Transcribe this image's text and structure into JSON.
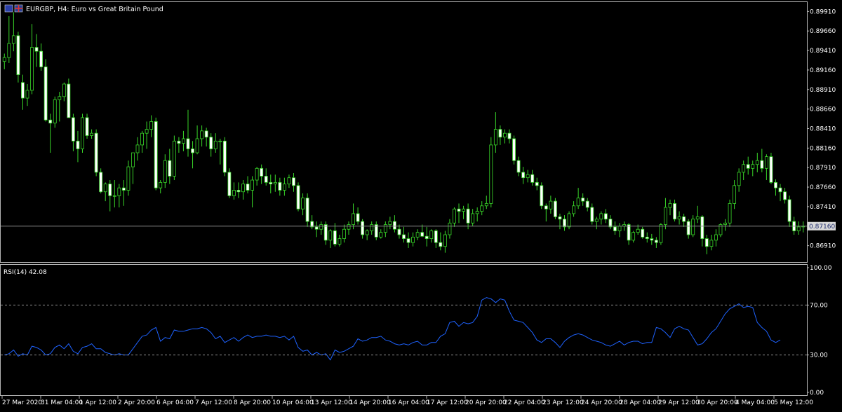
{
  "header": {
    "symbol_text": "EURGBP, H4:  Euro vs Great Britain Pound"
  },
  "colors": {
    "background": "#000000",
    "frame": "#b4b4b4",
    "bull_candle": "#39d829",
    "bear_body": "#ffffff",
    "price_line": "#8c8c8c",
    "rsi_line": "#1e62ff",
    "level_line": "#8c8c8c",
    "price_tag_bg": "#d8d8d8",
    "price_tag_text": "#1c2a6e"
  },
  "price_axis": {
    "ticks": [
      "0.89910",
      "0.89660",
      "0.89410",
      "0.89160",
      "0.88910",
      "0.88660",
      "0.88410",
      "0.88160",
      "0.87910",
      "0.87660",
      "0.87410",
      "0.87160",
      "0.86910"
    ],
    "current_price": "0.87160"
  },
  "rsi_panel": {
    "label": "RSI(14) 42.08",
    "ticks": [
      "100.00",
      "70.00",
      "30.00",
      "0.00"
    ],
    "levels": [
      70,
      30
    ]
  },
  "time_axis": {
    "labels": [
      "27 Mar 2020",
      "31 Mar 04:00",
      "1 Apr 12:00",
      "2 Apr 20:00",
      "6 Apr 04:00",
      "7 Apr 12:00",
      "8 Apr 20:00",
      "10 Apr 04:00",
      "13 Apr 12:00",
      "14 Apr 20:00",
      "16 Apr 04:00",
      "17 Apr 12:00",
      "20 Apr 20:00",
      "22 Apr 04:00",
      "23 Apr 12:00",
      "24 Apr 20:00",
      "28 Apr 04:00",
      "29 Apr 12:00",
      "30 Apr 20:00",
      "4 May 04:00",
      "5 May 12:00"
    ]
  },
  "chart_data": [
    {
      "type": "candlestick",
      "title": "EURGBP, H4:  Euro vs Great Britain Pound",
      "ylim": [
        0.867,
        0.9003
      ],
      "current_price": 0.8716,
      "candles": [
        [
          0.8927,
          0.8937,
          0.8917,
          0.8932
        ],
        [
          0.8932,
          0.8985,
          0.8925,
          0.895
        ],
        [
          0.895,
          0.899,
          0.894,
          0.896
        ],
        [
          0.896,
          0.8965,
          0.89,
          0.891
        ],
        [
          0.89,
          0.891,
          0.8865,
          0.888
        ],
        [
          0.888,
          0.8898,
          0.887,
          0.889
        ],
        [
          0.889,
          0.8975,
          0.8885,
          0.8945
        ],
        [
          0.8945,
          0.8962,
          0.892,
          0.894
        ],
        [
          0.894,
          0.895,
          0.8915,
          0.892
        ],
        [
          0.892,
          0.893,
          0.885,
          0.8852
        ],
        [
          0.8852,
          0.886,
          0.881,
          0.8848
        ],
        [
          0.8848,
          0.8882,
          0.8842,
          0.8878
        ],
        [
          0.8878,
          0.8888,
          0.885,
          0.8882
        ],
        [
          0.8882,
          0.89,
          0.8876,
          0.8898
        ],
        [
          0.8898,
          0.8905,
          0.8855,
          0.8855
        ],
        [
          0.8855,
          0.886,
          0.8812,
          0.8825
        ],
        [
          0.8825,
          0.8838,
          0.8798,
          0.8815
        ],
        [
          0.8815,
          0.886,
          0.881,
          0.8855
        ],
        [
          0.8855,
          0.886,
          0.8828,
          0.8832
        ],
        [
          0.8832,
          0.884,
          0.8828,
          0.8835
        ],
        [
          0.8835,
          0.884,
          0.878,
          0.8785
        ],
        [
          0.8785,
          0.879,
          0.8758,
          0.876
        ],
        [
          0.876,
          0.8772,
          0.8748,
          0.877
        ],
        [
          0.877,
          0.8775,
          0.8735,
          0.8755
        ],
        [
          0.8755,
          0.8775,
          0.874,
          0.8755
        ],
        [
          0.8755,
          0.877,
          0.874,
          0.8765
        ],
        [
          0.8765,
          0.8775,
          0.8742,
          0.8762
        ],
        [
          0.8762,
          0.88,
          0.8755,
          0.8792
        ],
        [
          0.8792,
          0.881,
          0.877,
          0.881
        ],
        [
          0.881,
          0.883,
          0.88,
          0.882
        ],
        [
          0.882,
          0.8838,
          0.881,
          0.8835
        ],
        [
          0.8835,
          0.885,
          0.8815,
          0.884
        ],
        [
          0.884,
          0.8858,
          0.883,
          0.885
        ],
        [
          0.885,
          0.8855,
          0.8762,
          0.8765
        ],
        [
          0.8765,
          0.8775,
          0.8758,
          0.8772
        ],
        [
          0.8772,
          0.8808,
          0.8765,
          0.88
        ],
        [
          0.88,
          0.8815,
          0.877,
          0.878
        ],
        [
          0.878,
          0.8832,
          0.8775,
          0.8825
        ],
        [
          0.8825,
          0.883,
          0.881,
          0.8822
        ],
        [
          0.8822,
          0.8838,
          0.8812,
          0.8828
        ],
        [
          0.8828,
          0.8865,
          0.8805,
          0.8815
        ],
        [
          0.8815,
          0.8825,
          0.879,
          0.881
        ],
        [
          0.881,
          0.8845,
          0.8808,
          0.8828
        ],
        [
          0.8828,
          0.8845,
          0.8818,
          0.8838
        ],
        [
          0.8838,
          0.8842,
          0.8818,
          0.883
        ],
        [
          0.883,
          0.8835,
          0.8805,
          0.8815
        ],
        [
          0.8815,
          0.8835,
          0.881,
          0.8825
        ],
        [
          0.8825,
          0.8828,
          0.8795,
          0.8825
        ],
        [
          0.8825,
          0.883,
          0.878,
          0.8785
        ],
        [
          0.8785,
          0.879,
          0.8752,
          0.8755
        ],
        [
          0.8755,
          0.8772,
          0.875,
          0.8762
        ],
        [
          0.8762,
          0.8772,
          0.8752,
          0.876
        ],
        [
          0.876,
          0.8775,
          0.875,
          0.877
        ],
        [
          0.877,
          0.878,
          0.8758,
          0.8762
        ],
        [
          0.8762,
          0.878,
          0.874,
          0.8775
        ],
        [
          0.8775,
          0.8792,
          0.8768,
          0.879
        ],
        [
          0.879,
          0.8795,
          0.877,
          0.878
        ],
        [
          0.878,
          0.879,
          0.8768,
          0.8772
        ],
        [
          0.8772,
          0.8782,
          0.8758,
          0.877
        ],
        [
          0.877,
          0.8782,
          0.876,
          0.8772
        ],
        [
          0.8772,
          0.8778,
          0.8755,
          0.8762
        ],
        [
          0.8762,
          0.8778,
          0.8755,
          0.877
        ],
        [
          0.877,
          0.8782,
          0.8765,
          0.8778
        ],
        [
          0.8778,
          0.8784,
          0.876,
          0.8768
        ],
        [
          0.8768,
          0.8772,
          0.8735,
          0.8738
        ],
        [
          0.8738,
          0.8758,
          0.873,
          0.8752
        ],
        [
          0.8752,
          0.8758,
          0.8715,
          0.8722
        ],
        [
          0.8722,
          0.873,
          0.8712,
          0.8715
        ],
        [
          0.8715,
          0.8722,
          0.8702,
          0.8712
        ],
        [
          0.8712,
          0.8722,
          0.8705,
          0.8718
        ],
        [
          0.8718,
          0.8722,
          0.8692,
          0.8698
        ],
        [
          0.8698,
          0.8712,
          0.8688,
          0.871
        ],
        [
          0.871,
          0.872,
          0.869,
          0.8693
        ],
        [
          0.8693,
          0.8705,
          0.869,
          0.87
        ],
        [
          0.87,
          0.8718,
          0.8695,
          0.8712
        ],
        [
          0.8712,
          0.8722,
          0.8705,
          0.8718
        ],
        [
          0.8718,
          0.8745,
          0.8712,
          0.8732
        ],
        [
          0.8732,
          0.874,
          0.8718,
          0.8722
        ],
        [
          0.8722,
          0.8725,
          0.87,
          0.8705
        ],
        [
          0.8705,
          0.8712,
          0.8698,
          0.871
        ],
        [
          0.871,
          0.8722,
          0.8705,
          0.8718
        ],
        [
          0.8718,
          0.8722,
          0.8698,
          0.8702
        ],
        [
          0.8702,
          0.8712,
          0.87,
          0.8708
        ],
        [
          0.8708,
          0.8722,
          0.8702,
          0.8718
        ],
        [
          0.8718,
          0.8728,
          0.8712,
          0.8722
        ],
        [
          0.8722,
          0.873,
          0.8708,
          0.8712
        ],
        [
          0.8712,
          0.8718,
          0.87,
          0.8705
        ],
        [
          0.8705,
          0.8715,
          0.8695,
          0.87
        ],
        [
          0.87,
          0.8708,
          0.8688,
          0.8695
        ],
        [
          0.8695,
          0.8708,
          0.869,
          0.8702
        ],
        [
          0.8702,
          0.8712,
          0.8698,
          0.8708
        ],
        [
          0.8708,
          0.8718,
          0.8702,
          0.8703
        ],
        [
          0.8703,
          0.8715,
          0.869,
          0.87
        ],
        [
          0.87,
          0.8712,
          0.8695,
          0.871
        ],
        [
          0.871,
          0.8712,
          0.8688,
          0.8695
        ],
        [
          0.8695,
          0.8708,
          0.8685,
          0.869
        ],
        [
          0.869,
          0.871,
          0.8682,
          0.8705
        ],
        [
          0.8705,
          0.8725,
          0.87,
          0.872
        ],
        [
          0.872,
          0.874,
          0.8715,
          0.8738
        ],
        [
          0.8738,
          0.8745,
          0.872,
          0.8735
        ],
        [
          0.8735,
          0.8742,
          0.8725,
          0.8738
        ],
        [
          0.8738,
          0.8745,
          0.8712,
          0.872
        ],
        [
          0.872,
          0.8738,
          0.8716,
          0.8732
        ],
        [
          0.8732,
          0.874,
          0.8722,
          0.8735
        ],
        [
          0.8735,
          0.8748,
          0.873,
          0.8742
        ],
        [
          0.8742,
          0.8755,
          0.8738,
          0.8745
        ],
        [
          0.8745,
          0.883,
          0.874,
          0.882
        ],
        [
          0.882,
          0.8862,
          0.881,
          0.884
        ],
        [
          0.884,
          0.8845,
          0.882,
          0.883
        ],
        [
          0.883,
          0.884,
          0.8822,
          0.8835
        ],
        [
          0.8835,
          0.884,
          0.8822,
          0.8828
        ],
        [
          0.8828,
          0.8832,
          0.8795,
          0.88
        ],
        [
          0.88,
          0.8805,
          0.878,
          0.8785
        ],
        [
          0.8785,
          0.8792,
          0.877,
          0.8778
        ],
        [
          0.8778,
          0.8788,
          0.8772,
          0.8782
        ],
        [
          0.8782,
          0.8788,
          0.8768,
          0.8772
        ],
        [
          0.8772,
          0.8778,
          0.8762,
          0.8768
        ],
        [
          0.8768,
          0.8772,
          0.8738,
          0.8742
        ],
        [
          0.8742,
          0.8745,
          0.8722,
          0.8738
        ],
        [
          0.8738,
          0.8755,
          0.8732,
          0.8748
        ],
        [
          0.8748,
          0.8752,
          0.8725,
          0.8728
        ],
        [
          0.8728,
          0.8732,
          0.8712,
          0.8725
        ],
        [
          0.8725,
          0.873,
          0.871,
          0.8715
        ],
        [
          0.8715,
          0.8735,
          0.8712,
          0.8732
        ],
        [
          0.8732,
          0.8748,
          0.8728,
          0.8742
        ],
        [
          0.8742,
          0.8765,
          0.8738,
          0.8752
        ],
        [
          0.8752,
          0.8758,
          0.8742,
          0.8748
        ],
        [
          0.8748,
          0.8752,
          0.8735,
          0.874
        ],
        [
          0.874,
          0.8745,
          0.8718,
          0.8722
        ],
        [
          0.8722,
          0.8728,
          0.8712,
          0.8725
        ],
        [
          0.8725,
          0.8735,
          0.8718,
          0.8732
        ],
        [
          0.8732,
          0.8738,
          0.872,
          0.8725
        ],
        [
          0.8725,
          0.873,
          0.8712,
          0.8715
        ],
        [
          0.8715,
          0.8722,
          0.8705,
          0.871
        ],
        [
          0.871,
          0.872,
          0.8702,
          0.8716
        ],
        [
          0.8716,
          0.8722,
          0.871,
          0.8718
        ],
        [
          0.8718,
          0.872,
          0.8692,
          0.8698
        ],
        [
          0.8698,
          0.871,
          0.8695,
          0.8708
        ],
        [
          0.8708,
          0.8718,
          0.8705,
          0.8712
        ],
        [
          0.8712,
          0.8715,
          0.87,
          0.8702
        ],
        [
          0.8702,
          0.8708,
          0.8695,
          0.87
        ],
        [
          0.87,
          0.8706,
          0.8692,
          0.8698
        ],
        [
          0.8698,
          0.8702,
          0.8688,
          0.8695
        ],
        [
          0.8695,
          0.872,
          0.8692,
          0.8718
        ],
        [
          0.8718,
          0.8752,
          0.8712,
          0.874
        ],
        [
          0.874,
          0.875,
          0.873,
          0.8745
        ],
        [
          0.8745,
          0.875,
          0.8722,
          0.8725
        ],
        [
          0.8725,
          0.8735,
          0.8718,
          0.8728
        ],
        [
          0.8728,
          0.8732,
          0.8715,
          0.8722
        ],
        [
          0.8722,
          0.8725,
          0.87,
          0.8705
        ],
        [
          0.8705,
          0.873,
          0.8702,
          0.8725
        ],
        [
          0.8725,
          0.8742,
          0.872,
          0.8728
        ],
        [
          0.8728,
          0.873,
          0.869,
          0.87
        ],
        [
          0.87,
          0.8705,
          0.868,
          0.869
        ],
        [
          0.869,
          0.8705,
          0.8685,
          0.8698
        ],
        [
          0.8698,
          0.8712,
          0.869,
          0.8705
        ],
        [
          0.8705,
          0.872,
          0.8702,
          0.8718
        ],
        [
          0.8718,
          0.8725,
          0.871,
          0.872
        ],
        [
          0.872,
          0.875,
          0.8715,
          0.8745
        ],
        [
          0.8745,
          0.8775,
          0.8738,
          0.8768
        ],
        [
          0.8768,
          0.879,
          0.876,
          0.8785
        ],
        [
          0.8785,
          0.88,
          0.8775,
          0.8795
        ],
        [
          0.8795,
          0.8805,
          0.8782,
          0.879
        ],
        [
          0.879,
          0.88,
          0.878,
          0.8795
        ],
        [
          0.8795,
          0.881,
          0.8785,
          0.88
        ],
        [
          0.88,
          0.8815,
          0.8785,
          0.879
        ],
        [
          0.879,
          0.8808,
          0.8775,
          0.8805
        ],
        [
          0.8805,
          0.881,
          0.877,
          0.8772
        ],
        [
          0.8772,
          0.8776,
          0.8755,
          0.8765
        ],
        [
          0.8765,
          0.877,
          0.8748,
          0.876
        ],
        [
          0.876,
          0.8765,
          0.8745,
          0.875
        ],
        [
          0.875,
          0.8755,
          0.8715,
          0.8722
        ],
        [
          0.8722,
          0.8728,
          0.8705,
          0.871
        ],
        [
          0.871,
          0.8722,
          0.8705,
          0.8715
        ],
        [
          0.8715,
          0.8722,
          0.8708,
          0.8716
        ]
      ]
    },
    {
      "type": "line",
      "title": "RSI(14) 42.08",
      "ylim": [
        0,
        100
      ],
      "levels": [
        30,
        70
      ],
      "last_value": 42.08,
      "values": [
        30,
        31,
        34,
        29,
        31,
        30,
        37,
        36,
        34,
        30,
        31,
        36,
        38,
        35,
        39,
        33,
        31,
        36,
        37,
        39,
        35,
        35,
        32,
        31,
        30,
        31,
        30,
        30,
        35,
        40,
        45,
        46,
        50,
        52,
        41,
        44,
        43,
        50,
        49,
        49,
        50,
        51,
        51,
        52,
        51,
        48,
        43,
        45,
        40,
        42,
        44,
        41,
        44,
        46,
        44,
        45,
        45,
        46,
        45,
        45,
        44,
        45,
        42,
        45,
        36,
        33,
        34,
        30,
        32,
        30,
        31,
        26,
        34,
        32,
        33,
        35,
        37,
        43,
        41,
        42,
        44,
        44,
        45,
        42,
        41,
        39,
        38,
        39,
        38,
        40,
        41,
        38,
        38,
        40,
        40,
        45,
        47,
        56,
        57,
        53,
        56,
        55,
        56,
        61,
        74,
        76,
        75,
        72,
        75,
        74,
        65,
        58,
        57,
        56,
        52,
        48,
        42,
        40,
        43,
        43,
        40,
        36,
        41,
        44,
        46,
        47,
        46,
        44,
        42,
        41,
        40,
        38,
        37,
        39,
        41,
        38,
        40,
        41,
        41,
        39,
        40,
        40,
        52,
        51,
        48,
        44,
        51,
        53,
        51,
        50,
        44,
        38,
        39,
        43,
        48,
        51,
        57,
        63,
        67,
        69,
        71,
        68,
        69,
        68,
        56,
        52,
        49,
        42,
        40,
        42
      ]
    }
  ]
}
